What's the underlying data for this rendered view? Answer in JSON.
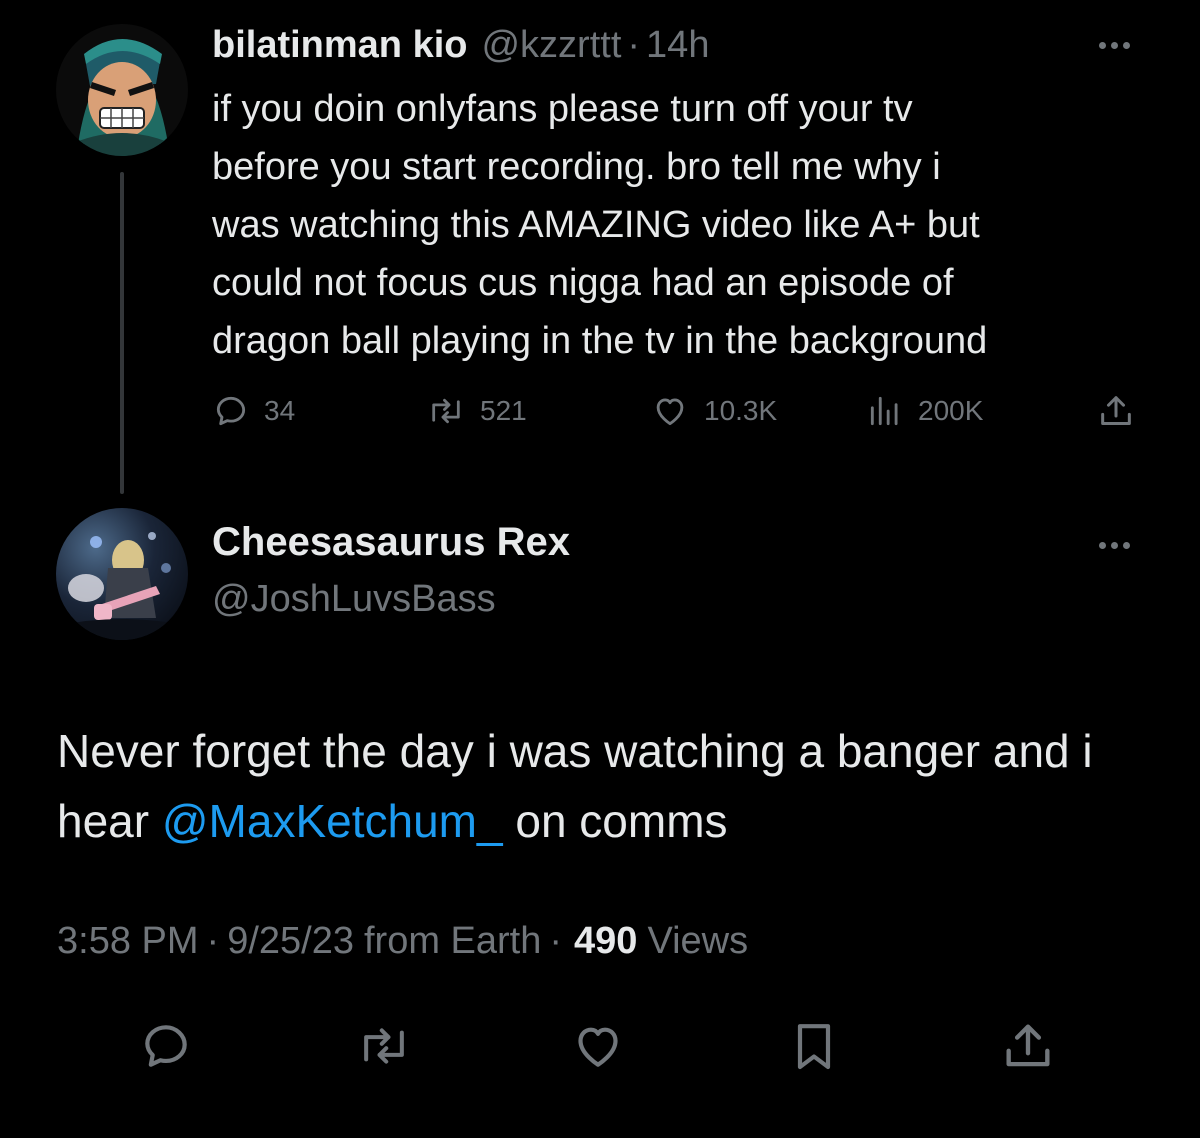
{
  "parent_tweet": {
    "display_name": "bilatinman kio",
    "handle": "@kzzrttt",
    "separator": "·",
    "time": "14h",
    "more_icon": "more-dots-icon",
    "text": "if you doin onlyfans please turn off your tv\nbefore you start recording. bro tell me why i\nwas watching this AMAZING video like A+ but\ncould not focus cus nigga had an episode of\ndragon ball playing in the tv in the background",
    "stats": {
      "replies": "34",
      "reposts": "521",
      "likes": "10.3K",
      "views": "200K"
    },
    "icons": [
      "reply-icon",
      "repost-icon",
      "like-icon",
      "views-icon",
      "share-icon"
    ]
  },
  "reply_tweet": {
    "display_name": "Cheesasaurus Rex",
    "handle": "@JoshLuvsBass",
    "text_before_mention": "Never forget the day i was watching a banger and i hear ",
    "mention": "@MaxKetchum_",
    "text_after_mention": " on comms",
    "time": "3:58 PM",
    "separator": "·",
    "date": "9/25/23",
    "source": "from Earth",
    "views_count": "490",
    "views_label": "Views",
    "icons": [
      "reply-icon",
      "repost-icon",
      "like-icon",
      "bookmark-icon",
      "share-icon"
    ]
  },
  "colors": {
    "background": "#000000",
    "primary_text": "#e7e9ea",
    "secondary_text": "#71767b",
    "link": "#1d9bf0",
    "thread_line": "#333639"
  }
}
